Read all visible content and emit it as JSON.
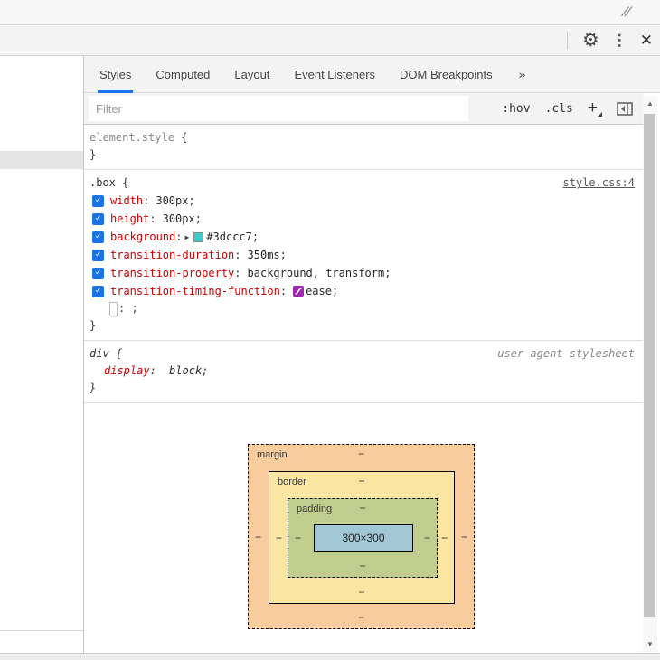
{
  "window": {
    "resize_handle": "⁄⁄"
  },
  "toolbar": {
    "gear": "⚙",
    "kebab": "⋮",
    "close": "✕"
  },
  "tabs": {
    "items": [
      "Styles",
      "Computed",
      "Layout",
      "Event Listeners",
      "DOM Breakpoints"
    ],
    "active": "Styles",
    "overflow": "»"
  },
  "filter": {
    "placeholder": "Filter",
    "hov": ":hov",
    "cls": ".cls",
    "plus": "+"
  },
  "punct": {
    "colon": ":",
    "semicolon": ";",
    "open_brace": "{",
    "close_brace": "}"
  },
  "glyphs": {
    "check": "✓",
    "expand_arrow": "▶",
    "scroll_up": "▲",
    "scroll_down": "▼",
    "dash": "−"
  },
  "colors": {
    "accent": "#1a73e8",
    "checkbox": "#1a73e8",
    "swatch": "#3dccc7",
    "bezier": "#9c27b0",
    "bm_margin": "#f9cc9d",
    "bm_border": "#fbe5a3",
    "bm_padding": "#c0cd8e",
    "bm_content": "#a2c7d4"
  },
  "sections": {
    "element_style": {
      "selector": "element.style"
    },
    "box_rule": {
      "selector": ".box",
      "source": "style.css:4",
      "properties": [
        {
          "name": "width",
          "value": "300px"
        },
        {
          "name": "height",
          "value": "300px"
        },
        {
          "name": "background",
          "value": "#3dccc7"
        },
        {
          "name": "transition-duration",
          "value": "350ms"
        },
        {
          "name": "transition-property",
          "value": "background, transform"
        },
        {
          "name": "transition-timing-function",
          "value": "ease"
        }
      ],
      "new_property": ": ;"
    },
    "div_rule": {
      "selector": "div",
      "source": "user agent stylesheet",
      "properties": [
        {
          "name": "display",
          "value": "block"
        }
      ]
    }
  },
  "box_model": {
    "margin_label": "margin",
    "border_label": "border",
    "padding_label": "padding",
    "content_size": "300×300"
  }
}
